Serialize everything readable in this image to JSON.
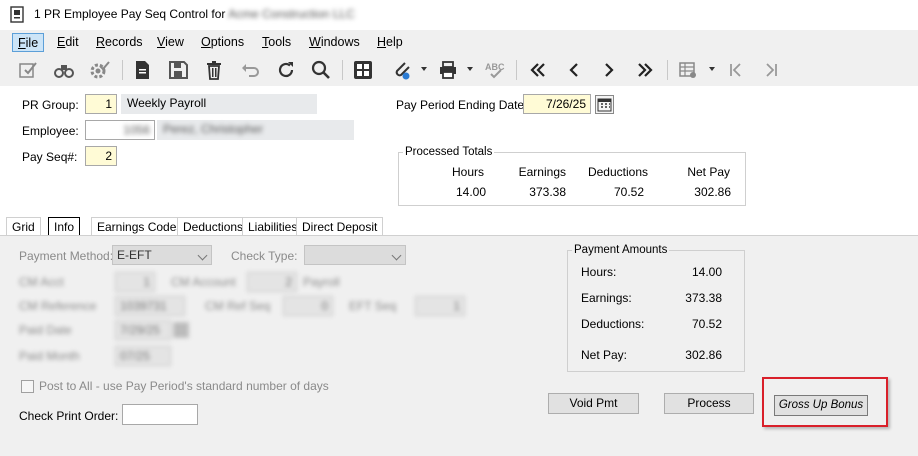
{
  "window": {
    "title": "1 PR Employee Pay Seq Control for",
    "company": "Acme Construction LLC"
  },
  "menu": [
    "File",
    "Edit",
    "Records",
    "View",
    "Options",
    "Tools",
    "Windows",
    "Help"
  ],
  "menu_mnemonics": [
    "F",
    "E",
    "R",
    "V",
    "O",
    "T",
    "W",
    "H"
  ],
  "toolbar": {
    "icons": [
      "check-edit-icon",
      "binoculars-icon",
      "gear-check-icon",
      "document-icon",
      "save-icon",
      "delete-icon",
      "undo-icon",
      "refresh-icon",
      "search-icon",
      "calculator-icon",
      "attach-icon",
      "print-icon",
      "spellcheck-icon",
      "first-record-icon",
      "prev-record-icon",
      "next-record-icon",
      "last-record-icon",
      "grid-options-icon",
      "first-page-icon",
      "last-page-icon"
    ]
  },
  "header": {
    "pr_group_label": "PR Group:",
    "pr_group_value": "1",
    "pr_group_desc": "Weekly Payroll",
    "employee_label": "Employee:",
    "employee_value": "1056",
    "employee_name": "Perez, Christopher",
    "pay_seq_label": "Pay Seq#:",
    "pay_seq_value": "2",
    "pay_period_label": "Pay Period Ending Date:",
    "pay_period_value": "7/26/25"
  },
  "processed_totals": {
    "legend": "Processed Totals",
    "headers": [
      "Hours",
      "Earnings",
      "Deductions",
      "Net Pay"
    ],
    "values": [
      "14.00",
      "373.38",
      "70.52",
      "302.86"
    ]
  },
  "tabs": [
    "Grid",
    "Info",
    "Earnings Codes",
    "Deductions",
    "Liabilities",
    "Direct Deposit"
  ],
  "selected_tab": "Info",
  "info": {
    "payment_method_label": "Payment Method:",
    "payment_method_value": "E-EFT",
    "check_type_label": "Check Type:",
    "check_type_value": "",
    "blurred_row1": [
      "CM Acct",
      "1",
      "CM Account",
      "2",
      "Payroll"
    ],
    "blurred_row2": [
      "CM Reference",
      "1039731",
      "CM Ref Seq",
      "0",
      "EFT Seq",
      "1"
    ],
    "blurred_row3": [
      "Paid Date",
      "7/29/25"
    ],
    "blurred_row4": [
      "Paid Month",
      "07/25"
    ],
    "post_to_all_label": "Post to All - use Pay Period's standard number of days",
    "check_print_order_label": "Check Print Order:",
    "check_print_order_value": ""
  },
  "payment_amounts": {
    "legend": "Payment Amounts",
    "rows": [
      {
        "label": "Hours:",
        "value": "14.00"
      },
      {
        "label": "Earnings:",
        "value": "373.38"
      },
      {
        "label": "Deductions:",
        "value": "70.52"
      },
      {
        "label": "Net Pay:",
        "value": "302.86"
      }
    ]
  },
  "buttons": {
    "void_pmt": "Void Pmt",
    "process": "Process",
    "gross_up_bonus": "Gross Up Bonus"
  },
  "colors": {
    "highlight_frame": "#d9202a",
    "required_field": "#fffbd6",
    "menu_active": "#cce4f7"
  }
}
